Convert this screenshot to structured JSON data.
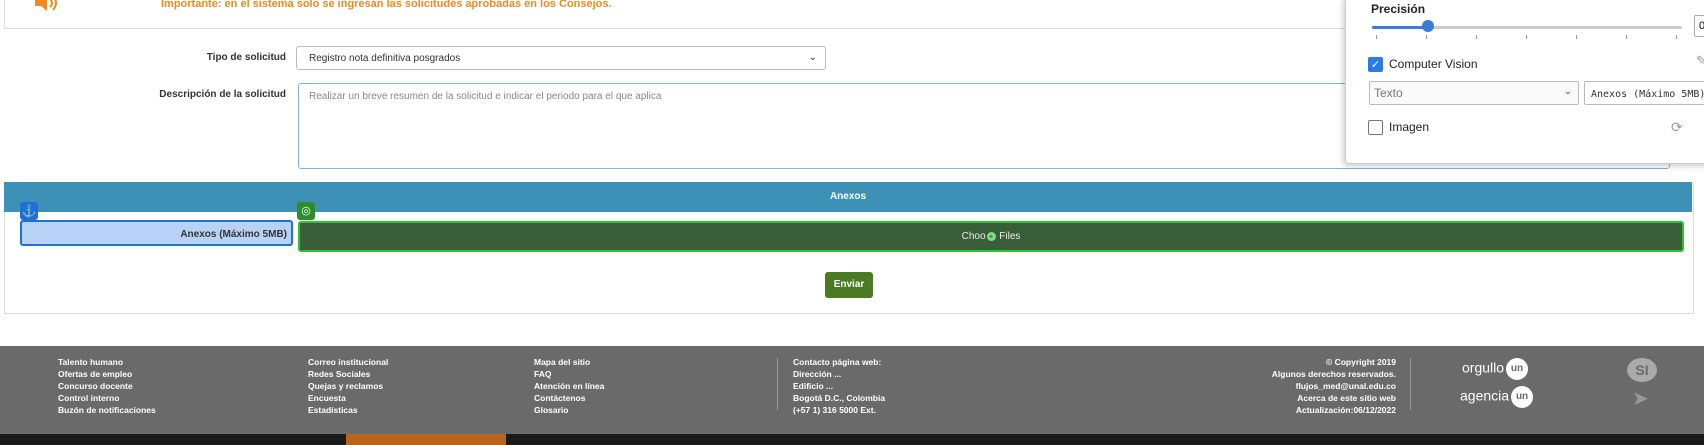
{
  "notice": {
    "message": "Importante: en el sistema solo se ingresan las solicitudes aprobadas en los Consejos."
  },
  "form": {
    "tipo_label": "Tipo de solicitud",
    "tipo_value": "Registro nota definitiva posgrados",
    "descripcion_label": "Descripción de la solicitud",
    "descripcion_placeholder": "Realizar un breve resumen de la solicitud e indicar el periodo para el que aplica",
    "anexos_header": "Anexos",
    "anexos_label": "Anexos (Máximo 5MB)",
    "choose_files_pre": "Choo",
    "choose_files_post": " Files",
    "submit_label": "Enviar"
  },
  "panel": {
    "precision_label": "Precisión",
    "precision_value": "0",
    "precision_fraction": 0.18,
    "computer_vision_label": "Computer Vision",
    "computer_vision_checked": true,
    "type_select_value": "Texto",
    "text_input_value": "Anexos (Máximo 5MB)",
    "image_label": "Imagen",
    "image_checked": false
  },
  "footer": {
    "col1": [
      "Talento humano",
      "Ofertas de empleo",
      "Concurso docente",
      "Control interno",
      "Buzón de notificaciones"
    ],
    "col2": [
      "Correo institucional",
      "Redes Sociales",
      "Quejas y reclamos",
      "Encuesta",
      "Estadísticas"
    ],
    "col3": [
      "Mapa del sitio",
      "FAQ",
      "Atención en línea",
      "Contáctenos",
      "Glosario"
    ],
    "col4": [
      "Contacto página web:",
      "Dirección ...",
      "Edificio ...",
      "Bogotá D.C., Colombia",
      "(+57 1) 316 5000 Ext."
    ],
    "col5": [
      "© Copyright 2019",
      "Algunos derechos reservados.",
      "flujos_med@unal.edu.co",
      "Acerca de este sitio web",
      "Actualización:06/12/2022"
    ],
    "logo1_text": "orgullo",
    "logo1_badge": "un",
    "logo2_text": "agencia",
    "logo2_badge": "un"
  }
}
